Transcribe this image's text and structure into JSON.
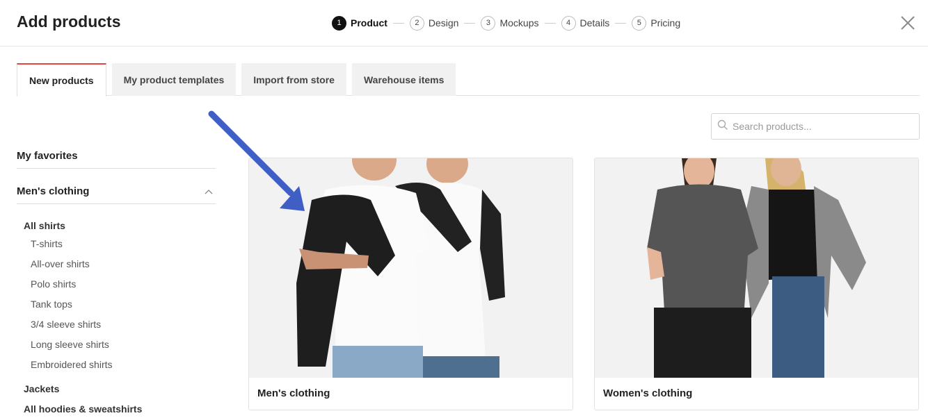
{
  "header": {
    "title": "Add products",
    "steps": [
      {
        "num": "1",
        "label": "Product"
      },
      {
        "num": "2",
        "label": "Design"
      },
      {
        "num": "3",
        "label": "Mockups"
      },
      {
        "num": "4",
        "label": "Details"
      },
      {
        "num": "5",
        "label": "Pricing"
      }
    ],
    "active_step": "1",
    "close_icon": "close-icon"
  },
  "tabs": [
    {
      "label": "New products"
    },
    {
      "label": "My product templates"
    },
    {
      "label": "Import from store"
    },
    {
      "label": "Warehouse items"
    }
  ],
  "search": {
    "placeholder": "Search products...",
    "value": ""
  },
  "sidebar": {
    "favorites": "My favorites",
    "section": "Men's clothing",
    "categories": [
      {
        "label": "All shirts"
      },
      {
        "label": "Jackets"
      },
      {
        "label": "All hoodies & sweatshirts"
      }
    ],
    "subitems": [
      "T-shirts",
      "All-over shirts",
      "Polo shirts",
      "Tank tops",
      "3/4 sleeve shirts",
      "Long sleeve shirts",
      "Embroidered shirts"
    ]
  },
  "cards": [
    {
      "label": "Men's clothing"
    },
    {
      "label": "Women's clothing"
    }
  ],
  "colors": {
    "accent_tab": "#e0463e",
    "arrow": "#3f5fc4"
  }
}
